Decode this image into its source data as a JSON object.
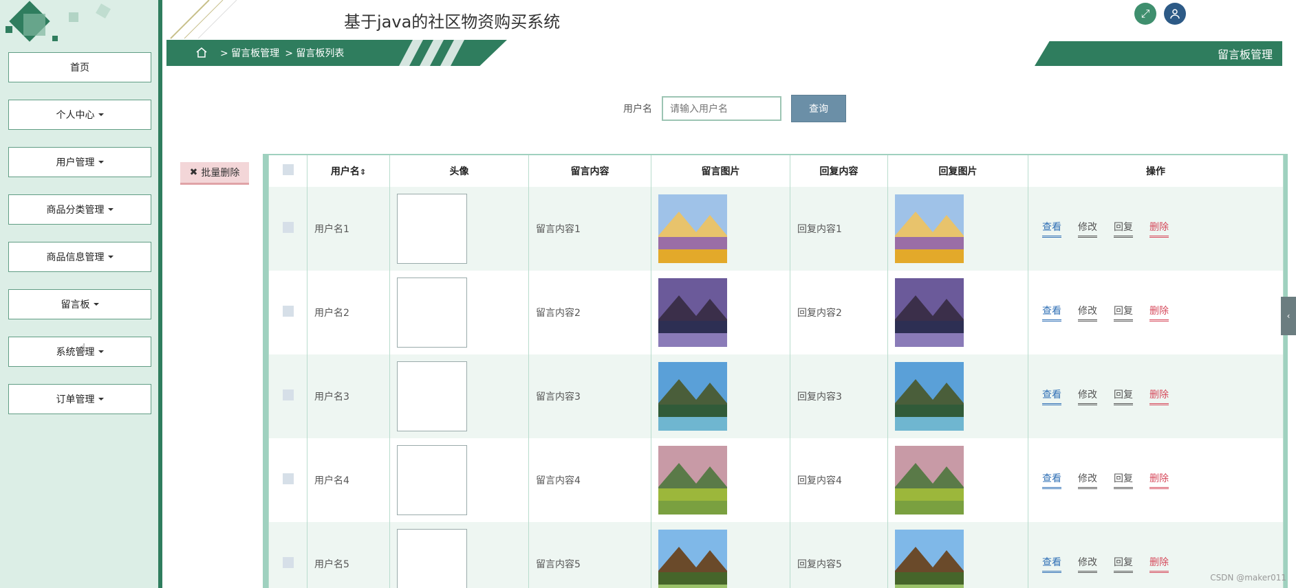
{
  "app": {
    "title": "基于java的社区物资购买系统"
  },
  "sidebar": {
    "items": [
      {
        "label": "首页",
        "caret": false
      },
      {
        "label": "个人中心",
        "caret": true
      },
      {
        "label": "用户管理",
        "caret": true
      },
      {
        "label": "商品分类管理",
        "caret": true
      },
      {
        "label": "商品信息管理",
        "caret": true
      },
      {
        "label": "留言板",
        "caret": true
      },
      {
        "label": "系统管理",
        "caret": true
      },
      {
        "label": "订单管理",
        "caret": true
      }
    ]
  },
  "breadcrumb": {
    "items": [
      "> 留言板管理",
      "> 留言板列表"
    ]
  },
  "page_title": "留言板管理",
  "search": {
    "label": "用户名",
    "placeholder": "请输入用户名",
    "button_label": "查询"
  },
  "toolbar": {
    "batch_delete_label": "批量删除"
  },
  "table": {
    "headers": [
      "用户名",
      "头像",
      "留言内容",
      "留言图片",
      "回复内容",
      "回复图片",
      "操作"
    ],
    "sort_indicator": "⇕",
    "rows": [
      {
        "username": "用户名1",
        "content": "留言内容1",
        "reply": "回复内容1",
        "image": "flower-field"
      },
      {
        "username": "用户名2",
        "content": "留言内容2",
        "reply": "回复内容2",
        "image": "mountain-lake-dusk"
      },
      {
        "username": "用户名3",
        "content": "留言内容3",
        "reply": "回复内容3",
        "image": "alpine-lake"
      },
      {
        "username": "用户名4",
        "content": "留言内容4",
        "reply": "回复内容4",
        "image": "meadow-mountain"
      },
      {
        "username": "用户名5",
        "content": "留言内容5",
        "reply": "回复内容5",
        "image": "forest-canopy"
      }
    ],
    "actions": {
      "view": "查看",
      "edit": "修改",
      "reply": "回复",
      "delete": "删除"
    }
  },
  "watermark": "CSDN @maker011",
  "colors": {
    "primary": "#2f7d5e",
    "accent": "#9fd1bf",
    "search_button": "#6b8fa7",
    "delete": "#d64a5c"
  }
}
